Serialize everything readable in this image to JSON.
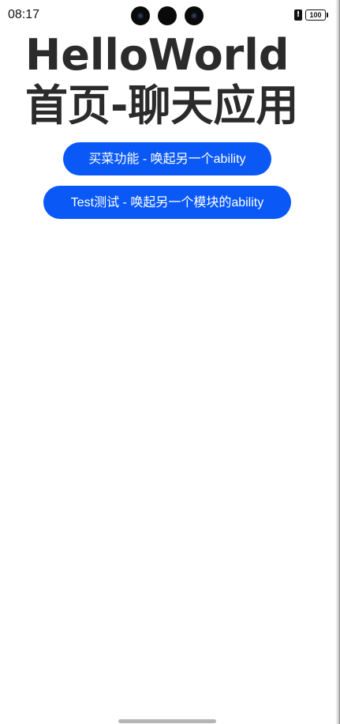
{
  "status_bar": {
    "time": "08:17",
    "battery_level": "100",
    "alert_glyph": "!"
  },
  "page": {
    "title": "HelloWorld 首页-聊天应用"
  },
  "buttons": {
    "grocery_label": "买菜功能 - 唤起另一个ability",
    "test_label": "Test测试 - 唤起另一个模块的ability"
  },
  "colors": {
    "accent": "#0a59f7",
    "title_text": "#2b2b2b",
    "background": "#ffffff"
  },
  "icons": {
    "cameras": [
      "front-camera-icon",
      "sensor-icon",
      "front-camera-icon"
    ],
    "alert": "alert-icon",
    "battery": "battery-icon"
  }
}
